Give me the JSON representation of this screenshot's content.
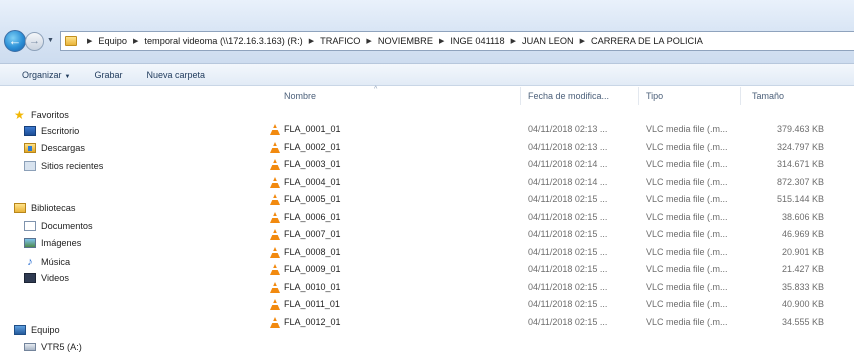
{
  "address_bar": {
    "crumbs": [
      "Equipo",
      "temporal videoma (\\\\172.16.3.163) (R:)",
      "TRAFICO",
      "NOVIEMBRE",
      "INGE 041118",
      "JUAN LEON",
      "CARRERA DE LA POLICIA"
    ]
  },
  "toolbar": {
    "organize_label": "Organizar",
    "burn_label": "Grabar",
    "new_folder_label": "Nueva carpeta"
  },
  "nav_pane": {
    "favorites": "Favoritos",
    "desktop": "Escritorio",
    "downloads": "Descargas",
    "recent": "Sitios recientes",
    "libraries": "Bibliotecas",
    "documents": "Documentos",
    "images": "Imágenes",
    "music": "Música",
    "videos": "Videos",
    "computer": "Equipo",
    "drive": "VTR5 (A:)"
  },
  "columns": {
    "name": "Nombre",
    "date": "Fecha de modifica...",
    "type": "Tipo",
    "size": "Tamaño"
  },
  "files": [
    {
      "name": "FLA_0001_01",
      "date": "04/11/2018 02:13 ...",
      "type": "VLC media file (.m...",
      "size": "379.463 KB"
    },
    {
      "name": "FLA_0002_01",
      "date": "04/11/2018 02:13 ...",
      "type": "VLC media file (.m...",
      "size": "324.797 KB"
    },
    {
      "name": "FLA_0003_01",
      "date": "04/11/2018 02:14 ...",
      "type": "VLC media file (.m...",
      "size": "314.671 KB"
    },
    {
      "name": "FLA_0004_01",
      "date": "04/11/2018 02:14 ...",
      "type": "VLC media file (.m...",
      "size": "872.307 KB"
    },
    {
      "name": "FLA_0005_01",
      "date": "04/11/2018 02:15 ...",
      "type": "VLC media file (.m...",
      "size": "515.144 KB"
    },
    {
      "name": "FLA_0006_01",
      "date": "04/11/2018 02:15 ...",
      "type": "VLC media file (.m...",
      "size": "38.606 KB"
    },
    {
      "name": "FLA_0007_01",
      "date": "04/11/2018 02:15 ...",
      "type": "VLC media file (.m...",
      "size": "46.969 KB"
    },
    {
      "name": "FLA_0008_01",
      "date": "04/11/2018 02:15 ...",
      "type": "VLC media file (.m...",
      "size": "20.901 KB"
    },
    {
      "name": "FLA_0009_01",
      "date": "04/11/2018 02:15 ...",
      "type": "VLC media file (.m...",
      "size": "21.427 KB"
    },
    {
      "name": "FLA_0010_01",
      "date": "04/11/2018 02:15 ...",
      "type": "VLC media file (.m...",
      "size": "35.833 KB"
    },
    {
      "name": "FLA_0011_01",
      "date": "04/11/2018 02:15 ...",
      "type": "VLC media file (.m...",
      "size": "40.900 KB"
    },
    {
      "name": "FLA_0012_01",
      "date": "04/11/2018 02:15 ...",
      "type": "VLC media file (.m...",
      "size": "34.555 KB"
    }
  ]
}
